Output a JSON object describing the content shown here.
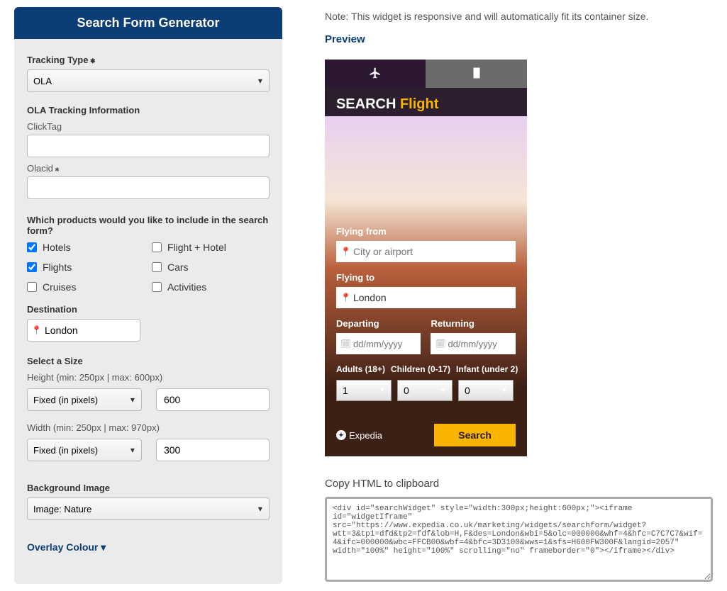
{
  "panel": {
    "title": "Search Form Generator",
    "tracking_type_label": "Tracking Type",
    "tracking_type_value": "OLA",
    "ola_info_label": "OLA Tracking Information",
    "clicktag_label": "ClickTag",
    "clicktag_value": "",
    "olacid_label": "Olacid",
    "olacid_value": "",
    "products_question": "Which products would you like to include in the search form?",
    "products": {
      "hotels": "Hotels",
      "flight_hotel": "Flight + Hotel",
      "flights": "Flights",
      "cars": "Cars",
      "cruises": "Cruises",
      "activities": "Activities"
    },
    "destination_label": "Destination",
    "destination_value": "London",
    "select_size_label": "Select a Size",
    "height_label": "Height (min: 250px | max: 600px)",
    "height_mode": "Fixed (in pixels)",
    "height_value": "600",
    "width_label": "Width (min: 250px | max: 970px)",
    "width_mode": "Fixed (in pixels)",
    "width_value": "300",
    "bg_image_label": "Background Image",
    "bg_image_value": "Image: Nature",
    "overlay_colour": "Overlay Colour"
  },
  "right": {
    "note": "Note: This widget is responsive and will automatically fit its container size.",
    "preview_label": "Preview",
    "copy_label": "Copy HTML to clipboard",
    "code": "<div id=\"searchWidget\" style=\"width:300px;height:600px;\"><iframe id=\"widgetIframe\" src=\"https://www.expedia.co.uk/marketing/widgets/searchform/widget?wtt=3&tp1=dfd&tp2=fdf&lob=H,F&des=London&wbi=5&olc=000000&whf=4&hfc=C7C7C7&wif=4&ifc=000000&wbc=FFCB00&wbf=4&bfc=3D3100&wws=1&sfs=H600FW300F&langid=2057\" width=\"100%\" height=\"100%\" scrolling=\"no\" frameborder=\"0\"></iframe></div>"
  },
  "widget": {
    "search_prefix": "SEARCH",
    "search_suffix": "Flight",
    "flying_from_label": "Flying from",
    "flying_from_placeholder": "City or airport",
    "flying_to_label": "Flying to",
    "flying_to_value": "London",
    "departing_label": "Departing",
    "returning_label": "Returning",
    "date_placeholder": "dd/mm/yyyy",
    "adults_label": "Adults (18+)",
    "children_label": "Children (0-17)",
    "infant_label": "Infant (under 2)",
    "adults_value": "1",
    "children_value": "0",
    "infant_value": "0",
    "logo_text": "Expedia",
    "search_button": "Search"
  }
}
